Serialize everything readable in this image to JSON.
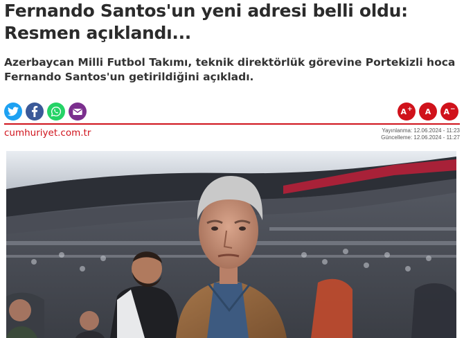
{
  "article": {
    "headline_lines": [
      "Fernando Santos'un yeni adresi belli oldu:",
      "Resmen açıklandı..."
    ],
    "summary_lines": [
      "Azerbaycan Milli Futbol Takımı, teknik direktörlük görevine Portekizli hoca",
      "Fernando Santos'un getirildiğini açıkladı."
    ]
  },
  "share": {
    "icons": [
      "twitter-icon",
      "facebook-icon",
      "whatsapp-icon",
      "mail-icon"
    ]
  },
  "font_controls": {
    "increase_label": "A",
    "increase_suffix": "+",
    "reset_label": "A",
    "decrease_label": "A",
    "decrease_suffix": "−"
  },
  "meta": {
    "source": "cumhuriyet.com.tr",
    "published": "Yayınlanma: 12.06.2024 - 11:23",
    "updated": "Güncelleme: 12.06.2024 - 11:27"
  },
  "colors": {
    "accent": "#d0121b",
    "twitter": "#1da1f2",
    "facebook": "#3b5998",
    "whatsapp": "#25d366",
    "mail": "#7b2f8e"
  }
}
